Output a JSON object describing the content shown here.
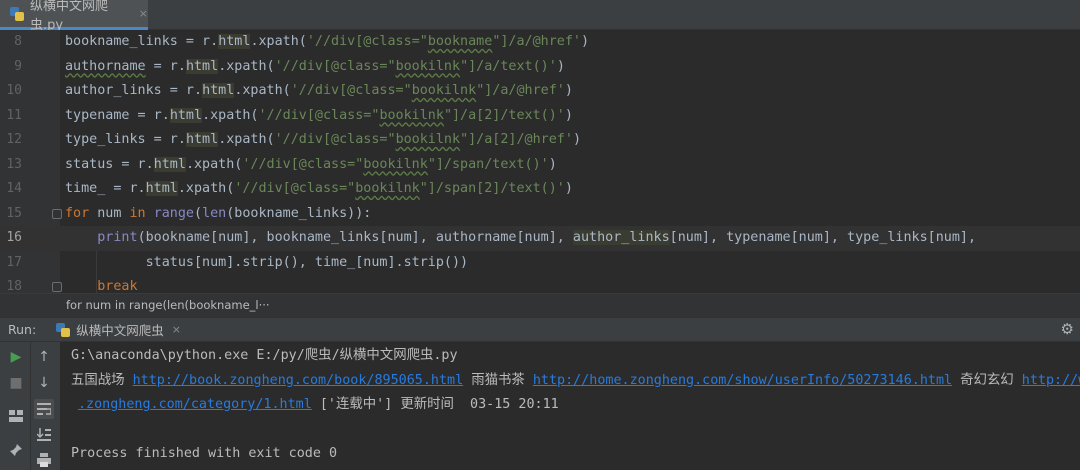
{
  "tab": {
    "label": "纵横中文网爬虫.py",
    "close": "×"
  },
  "editor": {
    "line_numbers": [
      "8",
      "9",
      "10",
      "11",
      "12",
      "13",
      "14",
      "15",
      "16",
      "17",
      "18"
    ],
    "code": [
      [
        {
          "t": "bookname_links = r."
        },
        {
          "t": "html",
          "c": "hl"
        },
        {
          "t": ".xpath("
        },
        {
          "t": "'//div[@class=\"",
          "c": "str"
        },
        {
          "t": "bookname",
          "c": "str uw"
        },
        {
          "t": "\"]/a/@href'",
          "c": "str"
        },
        {
          "t": ")"
        }
      ],
      [
        {
          "t": "authorname",
          "c": "uw"
        },
        {
          "t": " = r."
        },
        {
          "t": "html",
          "c": "hl"
        },
        {
          "t": ".xpath("
        },
        {
          "t": "'//div[@class=\"",
          "c": "str"
        },
        {
          "t": "bookilnk",
          "c": "str uw"
        },
        {
          "t": "\"]/a/text()'",
          "c": "str"
        },
        {
          "t": ")"
        }
      ],
      [
        {
          "t": "author_links = r."
        },
        {
          "t": "html",
          "c": "hl"
        },
        {
          "t": ".xpath("
        },
        {
          "t": "'//div[@class=\"",
          "c": "str"
        },
        {
          "t": "bookilnk",
          "c": "str uw"
        },
        {
          "t": "\"]/a/@href'",
          "c": "str"
        },
        {
          "t": ")"
        }
      ],
      [
        {
          "t": "typename = r."
        },
        {
          "t": "html",
          "c": "hl"
        },
        {
          "t": ".xpath("
        },
        {
          "t": "'//div[@class=\"",
          "c": "str"
        },
        {
          "t": "bookilnk",
          "c": "str uw"
        },
        {
          "t": "\"]/a[2]/text()'",
          "c": "str"
        },
        {
          "t": ")"
        }
      ],
      [
        {
          "t": "type_links = r."
        },
        {
          "t": "html",
          "c": "hl"
        },
        {
          "t": ".xpath("
        },
        {
          "t": "'//div[@class=\"",
          "c": "str"
        },
        {
          "t": "bookilnk",
          "c": "str uw"
        },
        {
          "t": "\"]/a[2]/@href'",
          "c": "str"
        },
        {
          "t": ")"
        }
      ],
      [
        {
          "t": "status = r."
        },
        {
          "t": "html",
          "c": "hl"
        },
        {
          "t": ".xpath("
        },
        {
          "t": "'//div[@class=\"",
          "c": "str"
        },
        {
          "t": "bookilnk",
          "c": "str uw"
        },
        {
          "t": "\"]/span/text()'",
          "c": "str"
        },
        {
          "t": ")"
        }
      ],
      [
        {
          "t": "time_ = r."
        },
        {
          "t": "html",
          "c": "hl"
        },
        {
          "t": ".xpath("
        },
        {
          "t": "'//div[@class=\"",
          "c": "str"
        },
        {
          "t": "bookilnk",
          "c": "str uw"
        },
        {
          "t": "\"]/span[2]/text()'",
          "c": "str"
        },
        {
          "t": ")"
        }
      ],
      [
        {
          "t": "for",
          "c": "kw"
        },
        {
          "t": " num "
        },
        {
          "t": "in",
          "c": "kw"
        },
        {
          "t": " "
        },
        {
          "t": "range",
          "c": "builtin"
        },
        {
          "t": "("
        },
        {
          "t": "len",
          "c": "builtin"
        },
        {
          "t": "(bookname_links)):"
        }
      ],
      [
        {
          "t": "    "
        },
        {
          "t": "print",
          "c": "builtin"
        },
        {
          "t": "(bookname[num], bookname_links[num], authorname[num], "
        },
        {
          "t": "author_links",
          "c": "hl"
        },
        {
          "t": "[num], typename[num], type_links[num],"
        }
      ],
      [
        {
          "t": "          status[num].strip(), time_[num].strip())"
        }
      ],
      [
        {
          "t": "    "
        },
        {
          "t": "break",
          "c": "kw"
        }
      ]
    ],
    "current_line_index": 8
  },
  "breadcrumb": "for num in range(len(bookname_l···",
  "run_panel": {
    "label": "Run:",
    "tab_label": "纵横中文网爬虫",
    "tab_close": "×",
    "gear_icon": "gear-icon"
  },
  "console": {
    "command": "G:\\anaconda\\python.exe E:/py/爬虫/纵横中文网爬虫.py",
    "output_line1": [
      {
        "t": "五国战场 "
      },
      {
        "t": "http://book.zongheng.com/book/895065.html",
        "c": "link"
      },
      {
        "t": " 雨猫书茶 "
      },
      {
        "t": "http://home.zongheng.com/show/userInfo/50273146.html",
        "c": "link"
      },
      {
        "t": " 奇幻玄幻 "
      },
      {
        "t": "http://www",
        "c": "link"
      }
    ],
    "output_line2": [
      {
        "t": ".zongheng.com/category/1.html",
        "c": "link"
      },
      {
        "t": " ['连载中'] 更新时间  03-15 20:11"
      }
    ],
    "exit_message": "Process finished with exit code 0"
  },
  "colors": {
    "editor_bg": "#2b2b2b",
    "keyword": "#cc7832",
    "string": "#6a8759",
    "builtin": "#8888c6",
    "link": "#287bde",
    "run_green": "#499c54"
  }
}
